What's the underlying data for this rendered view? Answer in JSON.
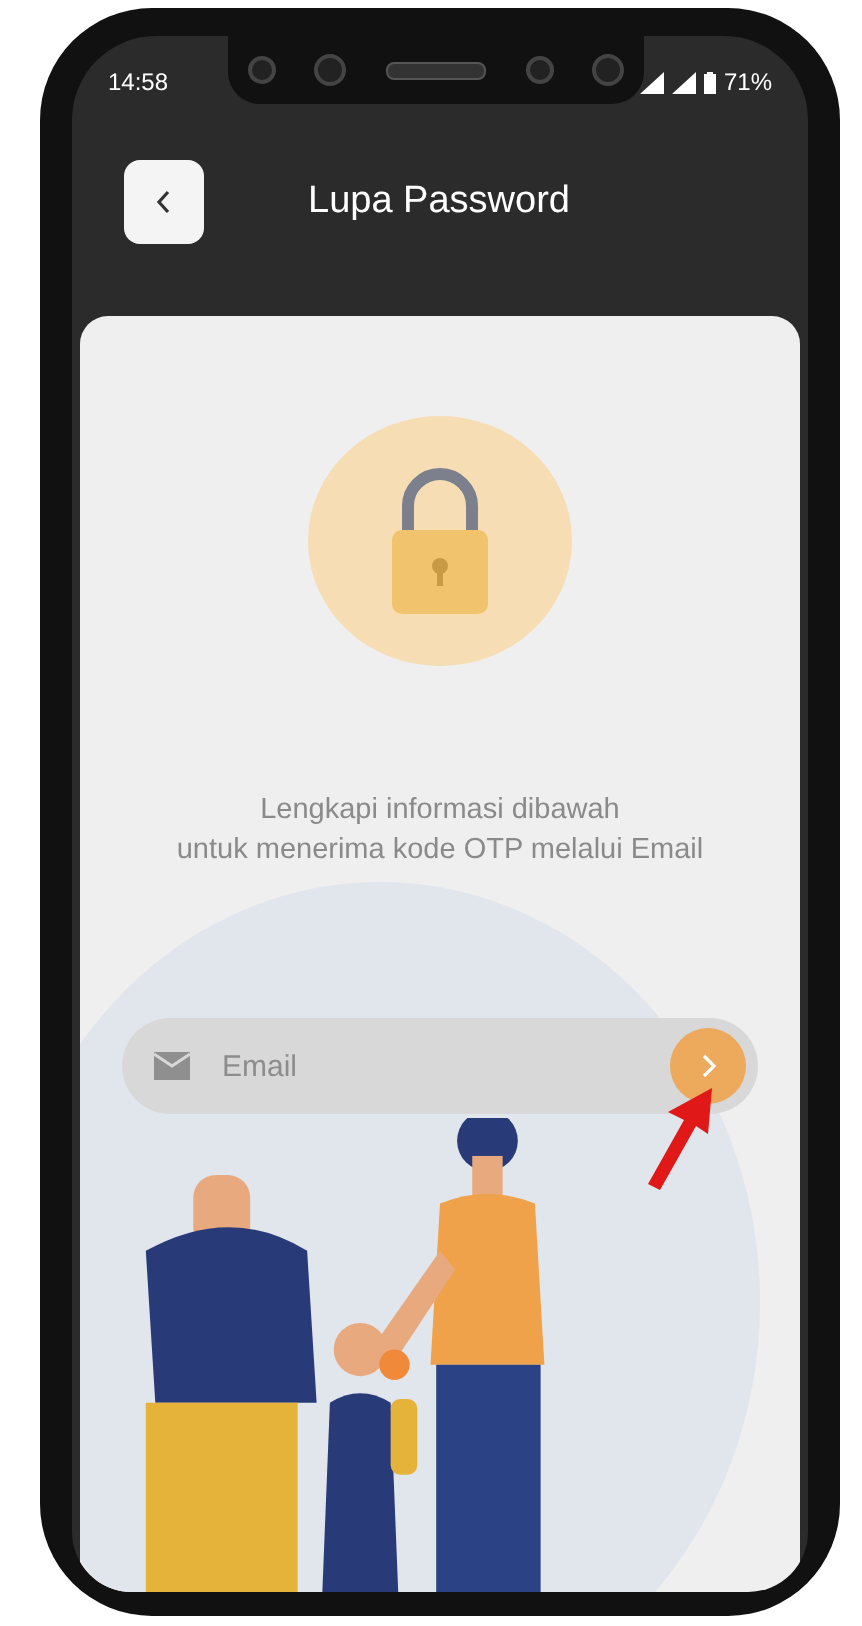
{
  "status_bar": {
    "time": "14:58",
    "battery": "71%"
  },
  "header": {
    "title": "Lupa Password"
  },
  "instructions": [
    "Lengkapi informasi dibawah",
    "untuk menerima kode OTP melalui Email"
  ],
  "email_field": {
    "placeholder": "Email"
  }
}
